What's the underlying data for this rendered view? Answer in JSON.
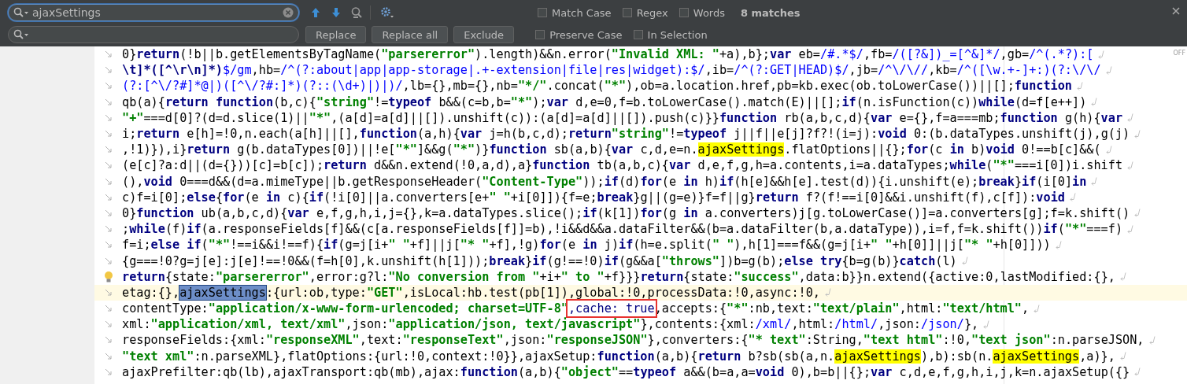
{
  "find_bar": {
    "search_value": "ajaxSettings",
    "options_row1": [
      {
        "label": "Match Case",
        "checked": false
      },
      {
        "label": "Regex",
        "checked": false
      },
      {
        "label": "Words",
        "checked": false
      }
    ],
    "match_count": "8 matches",
    "buttons": [
      "Replace",
      "Replace all",
      "Exclude"
    ],
    "options_row2": [
      {
        "label": "Preserve Case",
        "checked": false
      },
      {
        "label": "In Selection",
        "checked": false
      }
    ]
  },
  "editor": {
    "status_label": "OFF",
    "lines": [
      {
        "segments": [
          {
            "kind": "plain",
            "text": "0}"
          },
          {
            "kind": "keyword",
            "text": "return"
          },
          {
            "kind": "plain",
            "text": "(!b||b.getElementsByTagName("
          },
          {
            "kind": "string",
            "text": "\"parsererror\""
          },
          {
            "kind": "plain",
            "text": ").length)&&n.error("
          },
          {
            "kind": "string",
            "text": "\"Invalid XML: \""
          },
          {
            "kind": "plain",
            "text": "+a),b};"
          },
          {
            "kind": "keyword",
            "text": "var"
          },
          {
            "kind": "plain",
            "text": " eb="
          },
          {
            "kind": "regex",
            "text": "/#.*$/"
          },
          {
            "kind": "plain",
            "text": ",fb="
          },
          {
            "kind": "regex",
            "text": "/([?&])_=[^&]*/"
          },
          {
            "kind": "plain",
            "text": ",gb="
          },
          {
            "kind": "regex",
            "text": "/^(.*?):["
          }
        ]
      },
      {
        "segments": [
          {
            "kind": "keyword",
            "text": "\\t]*([^\\r\\n]*)"
          },
          {
            "kind": "regex",
            "text": "$/gm"
          },
          {
            "kind": "plain",
            "text": ",hb="
          },
          {
            "kind": "regex",
            "text": "/^(?:about|app|app-storage|.+-extension|file|res|widget):$/"
          },
          {
            "kind": "plain",
            "text": ",ib="
          },
          {
            "kind": "regex",
            "text": "/^(?:GET|HEAD)$/"
          },
          {
            "kind": "plain",
            "text": ",jb="
          },
          {
            "kind": "regex",
            "text": "/^\\/\\//"
          },
          {
            "kind": "plain",
            "text": ",kb="
          },
          {
            "kind": "regex",
            "text": "/^([\\w.+-]+:)(?:\\/\\/"
          }
        ]
      },
      {
        "segments": [
          {
            "kind": "regex",
            "text": "(?:[^\\/?#]*@|)([^\\/?#:]*)(?::(\\d+)|)|)/"
          },
          {
            "kind": "plain",
            "text": ",lb={},mb={},nb="
          },
          {
            "kind": "string",
            "text": "\"*/\""
          },
          {
            "kind": "plain",
            "text": ".concat("
          },
          {
            "kind": "string",
            "text": "\"*\""
          },
          {
            "kind": "plain",
            "text": "),ob=a.location.href,pb=kb.exec(ob.toLowerCase())||[];"
          },
          {
            "kind": "keyword",
            "text": "function"
          }
        ]
      },
      {
        "segments": [
          {
            "kind": "plain",
            "text": "qb(a){"
          },
          {
            "kind": "keyword",
            "text": "return function"
          },
          {
            "kind": "plain",
            "text": "(b,c){"
          },
          {
            "kind": "string",
            "text": "\"string\""
          },
          {
            "kind": "plain",
            "text": "!="
          },
          {
            "kind": "keyword",
            "text": "typeof"
          },
          {
            "kind": "plain",
            "text": " b&&(c=b,b="
          },
          {
            "kind": "string",
            "text": "\"*\""
          },
          {
            "kind": "plain",
            "text": ");"
          },
          {
            "kind": "keyword",
            "text": "var"
          },
          {
            "kind": "plain",
            "text": " d,e=0,f=b.toLowerCase().match(E)||[];"
          },
          {
            "kind": "keyword",
            "text": "if"
          },
          {
            "kind": "plain",
            "text": "(n.isFunction(c))"
          },
          {
            "kind": "keyword",
            "text": "while"
          },
          {
            "kind": "plain",
            "text": "(d=f[e++])"
          }
        ]
      },
      {
        "segments": [
          {
            "kind": "string",
            "text": "\"+\""
          },
          {
            "kind": "plain",
            "text": "===d[0]?(d=d.slice(1)||"
          },
          {
            "kind": "string",
            "text": "\"*\""
          },
          {
            "kind": "plain",
            "text": ",(a[d]=a[d]||[]).unshift(c)):(a[d]=a[d]||[]).push(c)}}"
          },
          {
            "kind": "keyword",
            "text": "function"
          },
          {
            "kind": "plain",
            "text": " rb(a,b,c,d){"
          },
          {
            "kind": "keyword",
            "text": "var"
          },
          {
            "kind": "plain",
            "text": " e={},f=a===mb;"
          },
          {
            "kind": "keyword",
            "text": "function"
          },
          {
            "kind": "plain",
            "text": " g(h){"
          },
          {
            "kind": "keyword",
            "text": "var"
          }
        ]
      },
      {
        "segments": [
          {
            "kind": "plain",
            "text": "i;"
          },
          {
            "kind": "keyword",
            "text": "return"
          },
          {
            "kind": "plain",
            "text": " e[h]=!0,n.each(a[h]||[],"
          },
          {
            "kind": "keyword",
            "text": "function"
          },
          {
            "kind": "plain",
            "text": "(a,h){"
          },
          {
            "kind": "keyword",
            "text": "var"
          },
          {
            "kind": "plain",
            "text": " j=h(b,c,d);"
          },
          {
            "kind": "keyword",
            "text": "return"
          },
          {
            "kind": "string",
            "text": "\"string\""
          },
          {
            "kind": "plain",
            "text": "!="
          },
          {
            "kind": "keyword",
            "text": "typeof"
          },
          {
            "kind": "plain",
            "text": " j||f||e[j]?f?!(i=j):"
          },
          {
            "kind": "keyword",
            "text": "void"
          },
          {
            "kind": "plain",
            "text": " 0:(b.dataTypes.unshift(j),g(j)"
          }
        ]
      },
      {
        "segments": [
          {
            "kind": "plain",
            "text": ",!1)}),i}"
          },
          {
            "kind": "keyword",
            "text": "return"
          },
          {
            "kind": "plain",
            "text": " g(b.dataTypes[0])||!e["
          },
          {
            "kind": "string",
            "text": "\"*\""
          },
          {
            "kind": "plain",
            "text": "]&&g("
          },
          {
            "kind": "string",
            "text": "\"*\""
          },
          {
            "kind": "plain",
            "text": ")}"
          },
          {
            "kind": "keyword",
            "text": "function"
          },
          {
            "kind": "plain",
            "text": " sb(a,b){"
          },
          {
            "kind": "keyword",
            "text": "var"
          },
          {
            "kind": "plain",
            "text": " c,d,e=n."
          },
          {
            "kind": "match",
            "text": "ajaxSettings"
          },
          {
            "kind": "plain",
            "text": ".flatOptions||{};"
          },
          {
            "kind": "keyword",
            "text": "for"
          },
          {
            "kind": "plain",
            "text": "(c "
          },
          {
            "kind": "keyword",
            "text": "in"
          },
          {
            "kind": "plain",
            "text": " b)"
          },
          {
            "kind": "keyword",
            "text": "void"
          },
          {
            "kind": "plain",
            "text": " 0!==b[c]&&("
          }
        ]
      },
      {
        "segments": [
          {
            "kind": "plain",
            "text": "(e[c]?a:d||(d={}))[c]=b[c]);"
          },
          {
            "kind": "keyword",
            "text": "return"
          },
          {
            "kind": "plain",
            "text": " d&&n.extend(!0,a,d),a}"
          },
          {
            "kind": "keyword",
            "text": "function"
          },
          {
            "kind": "plain",
            "text": " tb(a,b,c){"
          },
          {
            "kind": "keyword",
            "text": "var"
          },
          {
            "kind": "plain",
            "text": " d,e,f,g,h=a.contents,i=a.dataTypes;"
          },
          {
            "kind": "keyword",
            "text": "while"
          },
          {
            "kind": "plain",
            "text": "("
          },
          {
            "kind": "string",
            "text": "\"*\""
          },
          {
            "kind": "plain",
            "text": "===i[0])i.shift"
          }
        ]
      },
      {
        "segments": [
          {
            "kind": "plain",
            "text": "(),"
          },
          {
            "kind": "keyword",
            "text": "void"
          },
          {
            "kind": "plain",
            "text": " 0===d&&(d=a.mimeType||b.getResponseHeader("
          },
          {
            "kind": "string",
            "text": "\"Content-Type\""
          },
          {
            "kind": "plain",
            "text": "));"
          },
          {
            "kind": "keyword",
            "text": "if"
          },
          {
            "kind": "plain",
            "text": "(d)"
          },
          {
            "kind": "keyword",
            "text": "for"
          },
          {
            "kind": "plain",
            "text": "(e "
          },
          {
            "kind": "keyword",
            "text": "in"
          },
          {
            "kind": "plain",
            "text": " h)"
          },
          {
            "kind": "keyword",
            "text": "if"
          },
          {
            "kind": "plain",
            "text": "(h[e]&&h[e].test(d)){i.unshift(e);"
          },
          {
            "kind": "keyword",
            "text": "break"
          },
          {
            "kind": "plain",
            "text": "}"
          },
          {
            "kind": "keyword",
            "text": "if"
          },
          {
            "kind": "plain",
            "text": "(i[0]"
          },
          {
            "kind": "keyword",
            "text": "in"
          }
        ]
      },
      {
        "segments": [
          {
            "kind": "plain",
            "text": "c)f=i[0];"
          },
          {
            "kind": "keyword",
            "text": "else"
          },
          {
            "kind": "plain",
            "text": "{"
          },
          {
            "kind": "keyword",
            "text": "for"
          },
          {
            "kind": "plain",
            "text": "(e "
          },
          {
            "kind": "keyword",
            "text": "in"
          },
          {
            "kind": "plain",
            "text": " c){"
          },
          {
            "kind": "keyword",
            "text": "if"
          },
          {
            "kind": "plain",
            "text": "(!i[0]||a.converters[e+"
          },
          {
            "kind": "string",
            "text": "\" \""
          },
          {
            "kind": "plain",
            "text": "+i[0]]){f=e;"
          },
          {
            "kind": "keyword",
            "text": "break"
          },
          {
            "kind": "plain",
            "text": "}g||(g=e)}f=f||g}"
          },
          {
            "kind": "keyword",
            "text": "return"
          },
          {
            "kind": "plain",
            "text": " f?(f!==i[0]&&i.unshift(f),c[f]):"
          },
          {
            "kind": "keyword",
            "text": "void"
          }
        ]
      },
      {
        "segments": [
          {
            "kind": "plain",
            "text": "0}"
          },
          {
            "kind": "keyword",
            "text": "function"
          },
          {
            "kind": "plain",
            "text": " ub(a,b,c,d){"
          },
          {
            "kind": "keyword",
            "text": "var"
          },
          {
            "kind": "plain",
            "text": " e,f,g,h,i,j={},k=a.dataTypes.slice();"
          },
          {
            "kind": "keyword",
            "text": "if"
          },
          {
            "kind": "plain",
            "text": "(k[1])"
          },
          {
            "kind": "keyword",
            "text": "for"
          },
          {
            "kind": "plain",
            "text": "(g "
          },
          {
            "kind": "keyword",
            "text": "in"
          },
          {
            "kind": "plain",
            "text": " a.converters)j[g.toLowerCase()]=a.converters[g];f=k.shift()"
          }
        ]
      },
      {
        "segments": [
          {
            "kind": "plain",
            "text": ";"
          },
          {
            "kind": "keyword",
            "text": "while"
          },
          {
            "kind": "plain",
            "text": "(f)"
          },
          {
            "kind": "keyword",
            "text": "if"
          },
          {
            "kind": "plain",
            "text": "(a.responseFields[f]&&(c[a.responseFields[f]]=b),!i&&d&&a.dataFilter&&(b=a.dataFilter(b,a.dataType)),i=f,f=k.shift())"
          },
          {
            "kind": "keyword",
            "text": "if"
          },
          {
            "kind": "plain",
            "text": "("
          },
          {
            "kind": "string",
            "text": "\"*\""
          },
          {
            "kind": "plain",
            "text": "===f)"
          }
        ]
      },
      {
        "segments": [
          {
            "kind": "plain",
            "text": "f=i;"
          },
          {
            "kind": "keyword",
            "text": "else if"
          },
          {
            "kind": "plain",
            "text": "("
          },
          {
            "kind": "string",
            "text": "\"*\""
          },
          {
            "kind": "plain",
            "text": "!==i&&i!==f){"
          },
          {
            "kind": "keyword",
            "text": "if"
          },
          {
            "kind": "plain",
            "text": "(g=j[i+"
          },
          {
            "kind": "string",
            "text": "\" \""
          },
          {
            "kind": "plain",
            "text": "+f]||j["
          },
          {
            "kind": "string",
            "text": "\"* \""
          },
          {
            "kind": "plain",
            "text": "+f],!g)"
          },
          {
            "kind": "keyword",
            "text": "for"
          },
          {
            "kind": "plain",
            "text": "(e "
          },
          {
            "kind": "keyword",
            "text": "in"
          },
          {
            "kind": "plain",
            "text": " j)"
          },
          {
            "kind": "keyword",
            "text": "if"
          },
          {
            "kind": "plain",
            "text": "(h=e.split("
          },
          {
            "kind": "string",
            "text": "\" \""
          },
          {
            "kind": "plain",
            "text": "),h[1]===f&&(g=j[i+"
          },
          {
            "kind": "string",
            "text": "\" \""
          },
          {
            "kind": "plain",
            "text": "+h[0]]||j["
          },
          {
            "kind": "string",
            "text": "\"* \""
          },
          {
            "kind": "plain",
            "text": "+h[0]]))"
          }
        ]
      },
      {
        "segments": [
          {
            "kind": "plain",
            "text": "{g===!0?g=j[e]:j[e]!==!0&&(f=h[0],k.unshift(h[1]));"
          },
          {
            "kind": "keyword",
            "text": "break"
          },
          {
            "kind": "plain",
            "text": "}"
          },
          {
            "kind": "keyword",
            "text": "if"
          },
          {
            "kind": "plain",
            "text": "(g!==!0)"
          },
          {
            "kind": "keyword",
            "text": "if"
          },
          {
            "kind": "plain",
            "text": "(g&&a["
          },
          {
            "kind": "string",
            "text": "\"throws\""
          },
          {
            "kind": "plain",
            "text": "])b=g(b);"
          },
          {
            "kind": "keyword",
            "text": "else try"
          },
          {
            "kind": "plain",
            "text": "{b=g(b)}"
          },
          {
            "kind": "keyword",
            "text": "catch"
          },
          {
            "kind": "plain",
            "text": "(l)"
          }
        ]
      },
      {
        "bulb": true,
        "segments": [
          {
            "kind": "keyword",
            "text": "return"
          },
          {
            "kind": "plain",
            "text": "{state:"
          },
          {
            "kind": "string",
            "text": "\"parsererror\""
          },
          {
            "kind": "plain",
            "text": ",error:g?l:"
          },
          {
            "kind": "string",
            "text": "\"No conversion from \""
          },
          {
            "kind": "plain",
            "text": "+i+"
          },
          {
            "kind": "string",
            "text": "\" to \""
          },
          {
            "kind": "plain",
            "text": "+f}}}"
          },
          {
            "kind": "keyword",
            "text": "return"
          },
          {
            "kind": "plain",
            "text": "{state:"
          },
          {
            "kind": "string",
            "text": "\"success\""
          },
          {
            "kind": "plain",
            "text": ",data:b}}n.extend({active:0,lastModified:{},"
          }
        ]
      },
      {
        "current": true,
        "segments": [
          {
            "kind": "plain",
            "text": "etag:{},"
          },
          {
            "kind": "current-match",
            "text": "ajaxSettings"
          },
          {
            "kind": "plain",
            "text": ":{url:ob,type:"
          },
          {
            "kind": "string",
            "text": "\"GET\""
          },
          {
            "kind": "plain",
            "text": ",isLocal:hb.test(pb[1]),global:!0,processData:!0,async:!0,"
          }
        ]
      },
      {
        "segments": [
          {
            "kind": "plain",
            "text": "contentType:"
          },
          {
            "kind": "string",
            "text": "\"application/x-www-form-urlencoded; charset=UTF-8\""
          },
          {
            "kind": "boxed",
            "text": ",cache: true"
          },
          {
            "kind": "plain",
            "text": ",accepts:{"
          },
          {
            "kind": "string",
            "text": "\"*\""
          },
          {
            "kind": "plain",
            "text": ":nb,text:"
          },
          {
            "kind": "string",
            "text": "\"text/plain\""
          },
          {
            "kind": "plain",
            "text": ",html:"
          },
          {
            "kind": "string",
            "text": "\"text/html\""
          },
          {
            "kind": "plain",
            "text": ","
          }
        ]
      },
      {
        "segments": [
          {
            "kind": "plain",
            "text": "xml:"
          },
          {
            "kind": "string",
            "text": "\"application/xml, text/xml\""
          },
          {
            "kind": "plain",
            "text": ",json:"
          },
          {
            "kind": "string",
            "text": "\"application/json, text/javascript\""
          },
          {
            "kind": "plain",
            "text": "},contents:{xml:"
          },
          {
            "kind": "regex",
            "text": "/xml/"
          },
          {
            "kind": "plain",
            "text": ",html:"
          },
          {
            "kind": "regex",
            "text": "/html/"
          },
          {
            "kind": "plain",
            "text": ",json:"
          },
          {
            "kind": "regex",
            "text": "/json/"
          },
          {
            "kind": "plain",
            "text": "},"
          }
        ]
      },
      {
        "segments": [
          {
            "kind": "plain",
            "text": "responseFields:{xml:"
          },
          {
            "kind": "string",
            "text": "\"responseXML\""
          },
          {
            "kind": "plain",
            "text": ",text:"
          },
          {
            "kind": "string",
            "text": "\"responseText\""
          },
          {
            "kind": "plain",
            "text": ",json:"
          },
          {
            "kind": "string",
            "text": "\"responseJSON\""
          },
          {
            "kind": "plain",
            "text": "},converters:{"
          },
          {
            "kind": "string",
            "text": "\"* text\""
          },
          {
            "kind": "plain",
            "text": ":String,"
          },
          {
            "kind": "string",
            "text": "\"text html\""
          },
          {
            "kind": "plain",
            "text": ":!0,"
          },
          {
            "kind": "string",
            "text": "\"text json\""
          },
          {
            "kind": "plain",
            "text": ":n.parseJSON,"
          }
        ]
      },
      {
        "segments": [
          {
            "kind": "string",
            "text": "\"text xml\""
          },
          {
            "kind": "plain",
            "text": ":n.parseXML},flatOptions:{url:!0,context:!0}},ajaxSetup:"
          },
          {
            "kind": "keyword",
            "text": "function"
          },
          {
            "kind": "plain",
            "text": "(a,b){"
          },
          {
            "kind": "keyword",
            "text": "return"
          },
          {
            "kind": "plain",
            "text": " b?sb(sb(a,n."
          },
          {
            "kind": "match",
            "text": "ajaxSettings"
          },
          {
            "kind": "plain",
            "text": "),b):sb(n."
          },
          {
            "kind": "match",
            "text": "ajaxSettings"
          },
          {
            "kind": "plain",
            "text": ",a)},"
          }
        ]
      },
      {
        "segments": [
          {
            "kind": "plain",
            "text": "ajaxPrefilter:qb(lb),ajaxTransport:qb(mb),ajax:"
          },
          {
            "kind": "keyword",
            "text": "function"
          },
          {
            "kind": "plain",
            "text": "(a,b){"
          },
          {
            "kind": "string",
            "text": "\"object\""
          },
          {
            "kind": "plain",
            "text": "=="
          },
          {
            "kind": "keyword",
            "text": "typeof"
          },
          {
            "kind": "plain",
            "text": " a&&(b=a,a="
          },
          {
            "kind": "keyword",
            "text": "void"
          },
          {
            "kind": "plain",
            "text": " 0),b=b||{};"
          },
          {
            "kind": "keyword",
            "text": "var"
          },
          {
            "kind": "plain",
            "text": " c,d,e,f,g,h,i,j,k=n.ajaxSetup({}"
          }
        ]
      }
    ]
  }
}
